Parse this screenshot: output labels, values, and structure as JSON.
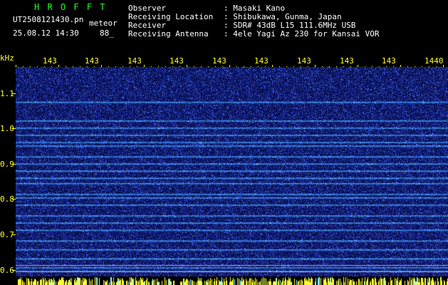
{
  "header": {
    "app_name": "H R O F F T",
    "filename": "UT2508121430.pn",
    "tag": "meteor",
    "datetime": "25.08.12 14:30",
    "count": "88_",
    "info": [
      {
        "label": "Observer",
        "value": ": Masaki Kano"
      },
      {
        "label": "Receiving Location",
        "value": ": Shibukawa, Gunma, Japan"
      },
      {
        "label": "Receiver",
        "value": ": SDR# 43dB L15 111.6MHz USB"
      },
      {
        "label": "Receiving Antenna",
        "value": ": 4ele Yagi Az 230 for Kansai VOR"
      }
    ]
  },
  "spectrogram": {
    "y_unit": "kHz",
    "y_ticks": [
      "1.1",
      "1.0",
      "0.9",
      "0.8",
      "0.7",
      "0.6"
    ],
    "y_range": [
      0.59,
      1.175
    ],
    "x_labels": [
      "143",
      "143",
      "143",
      "143",
      "143",
      "143",
      "143",
      "143",
      "143",
      "1440"
    ],
    "colors": {
      "background": "#080d48",
      "signal": "#4a7cff",
      "peak": "#aaffff",
      "axis": "#ffff33"
    },
    "carrier_lines_khz": [
      1.077,
      1.025,
      1.005,
      0.985,
      0.965,
      0.955,
      0.925,
      0.905,
      0.885,
      0.865,
      0.85,
      0.82,
      0.81,
      0.79,
      0.76,
      0.74,
      0.72,
      0.69,
      0.665,
      0.64,
      0.615,
      0.605
    ]
  }
}
